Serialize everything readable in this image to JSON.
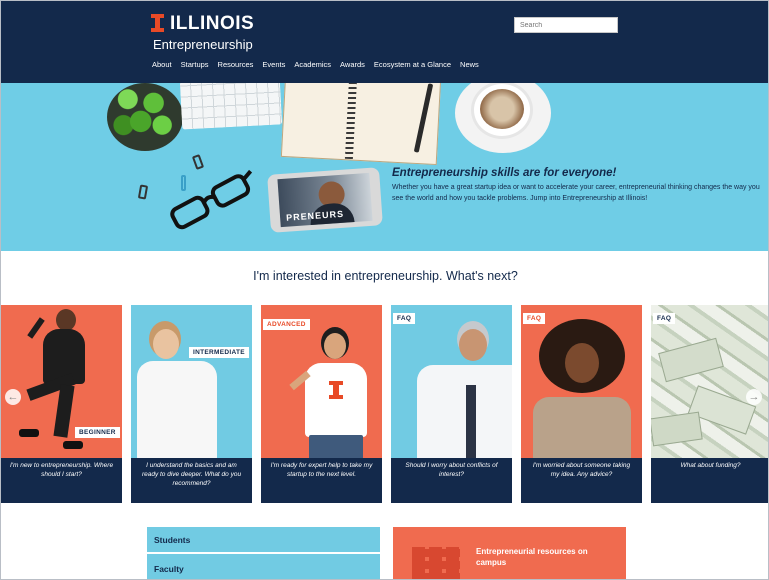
{
  "header": {
    "brand": "ILLINOIS",
    "subtitle": "Entrepreneurship",
    "search_placeholder": "Search",
    "nav": [
      "About",
      "Startups",
      "Resources",
      "Events",
      "Academics",
      "Awards",
      "Ecosystem at a Glance",
      "News"
    ]
  },
  "hero": {
    "title": "Entrepreneurship skills are for everyone!",
    "body": "Whether you have a great startup idea or want to accelerate your career, entrepreneurial thinking changes the way you see the world and how you tackle problems. Jump into Entrepreneurship at Illinois!",
    "video_label": "PRENEURS"
  },
  "interest_heading": "I'm interested in entrepreneurship. What's next?",
  "cards": [
    {
      "tag": "BEGINNER",
      "caption": "I'm new to entrepreneurship. Where should I start?"
    },
    {
      "tag": "INTERMEDIATE",
      "caption": "I understand the basics and am ready to dive deeper. What do you recommend?"
    },
    {
      "tag": "ADVANCED",
      "caption": "I'm ready for expert help to take my startup to the next level."
    },
    {
      "tag": "FAQ",
      "caption": "Should I worry about conflicts of interest?"
    },
    {
      "tag": "FAQ",
      "caption": "I'm worried about someone taking my idea. Any advice?"
    },
    {
      "tag": "FAQ",
      "caption": "What about funding?"
    }
  ],
  "carousel": {
    "prev_icon": "←",
    "next_icon": "→"
  },
  "audience_links": [
    "Students",
    "Faculty"
  ],
  "resources_link": "Entrepreneurial resources on campus",
  "colors": {
    "navy": "#13294b",
    "orange": "#e84a27",
    "sky": "#71cbe3",
    "coral": "#f06b4f"
  }
}
